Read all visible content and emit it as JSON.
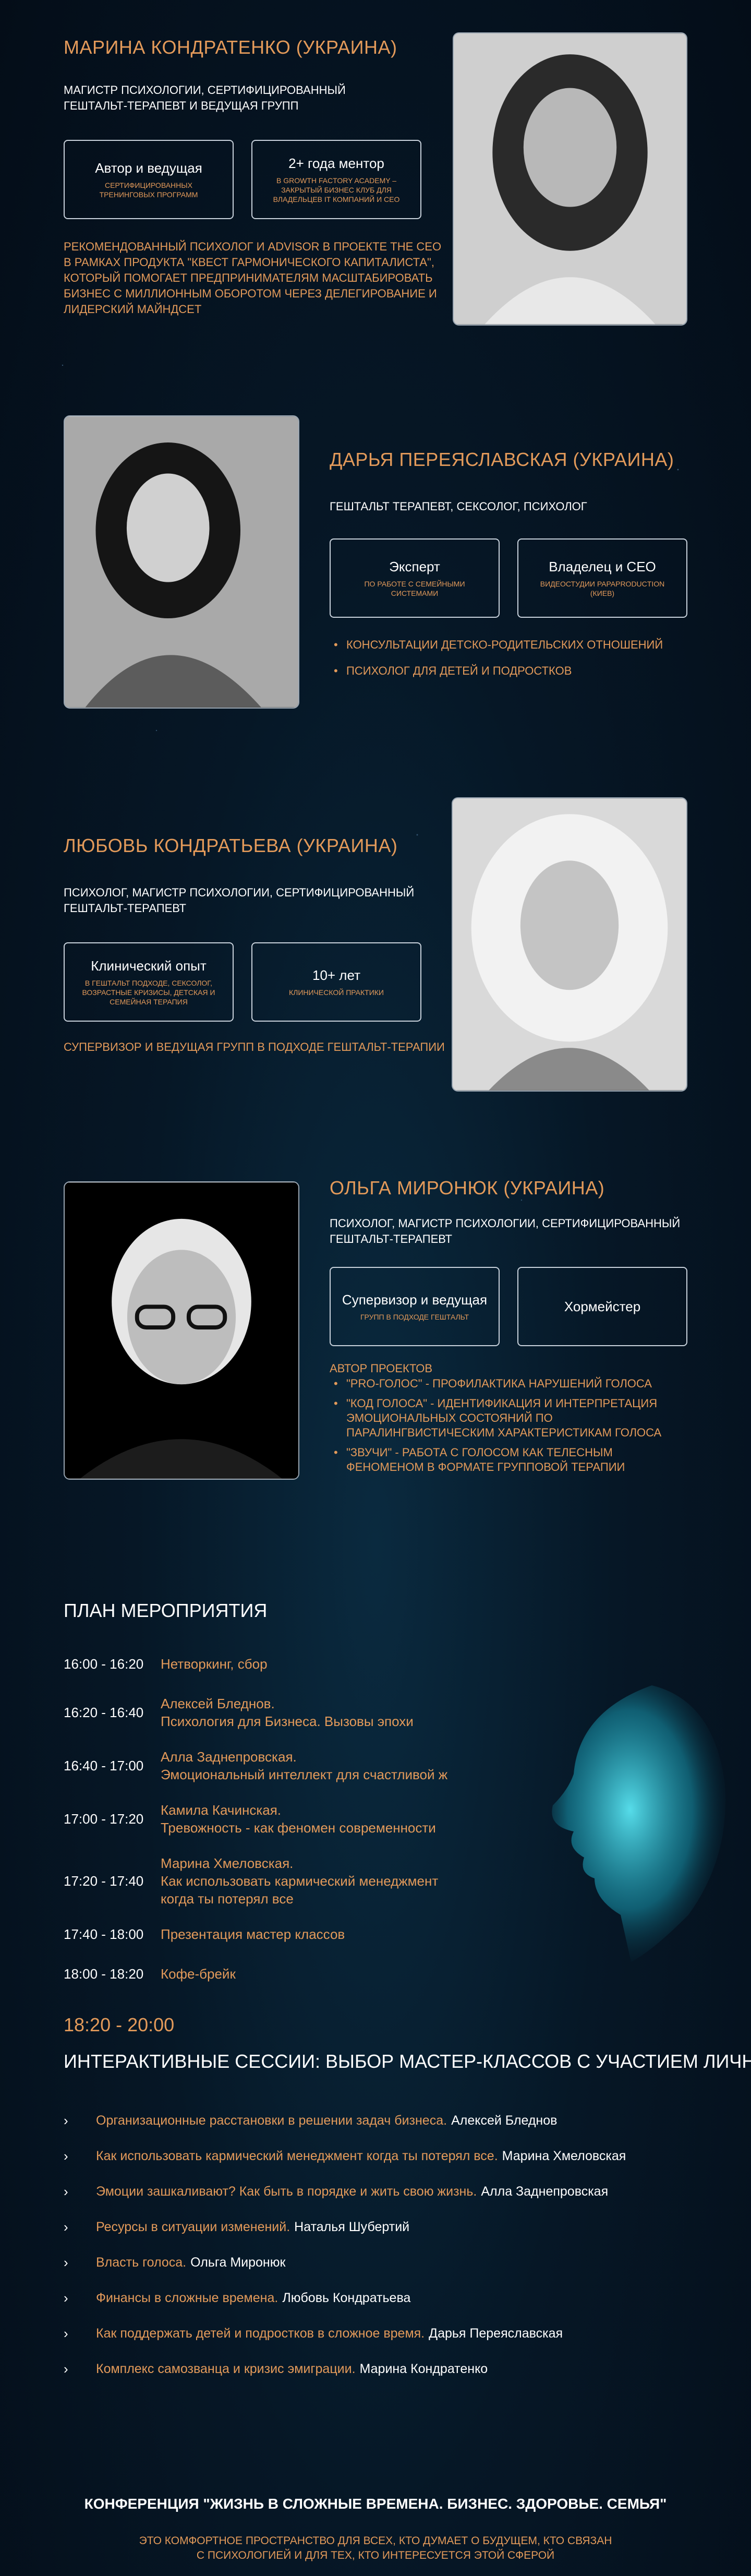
{
  "speakers": [
    {
      "name": "МАРИНА КОНДРАТЕНКО (УКРАИНА)",
      "subtitle_line1": "МАГИСТР ПСИХОЛОГИИ, СЕРТИФИЦИРОВАННЫЙ",
      "subtitle_line2": "ГЕШТАЛЬТ-ТЕРАПЕВТ И ВЕДУЩАЯ  ГРУПП",
      "cards": [
        {
          "title": "Автор и ведущая",
          "sub_line1": "СЕРТИФИЦИРОВАННЫХ",
          "sub_line2": "ТРЕНИНГОВЫХ ПРОГРАММ"
        },
        {
          "title": "2+ года ментор",
          "sub_line1": "В GROWTH FACTORY ACADEMY –",
          "sub_line2": "ЗАКРЫТЫЙ БИЗНЕС КЛУБ ДЛЯ",
          "sub_line3": "ВЛАДЕЛЬЦЕВ IT КОМПАНИЙ И CEO"
        }
      ],
      "desc_lines": [
        "РЕКОМЕНДОВАННЫЙ ПСИХОЛОГ И ADVISOR В ПРОЕКТЕ THE CEO",
        "В РАМКАХ ПРОДУКТА \"КВЕСТ ГАРМОНИЧЕСКОГО КАПИТАЛИСТА\",",
        "КОТОРЫЙ ПОМОГАЕТ ПРЕДПРИНИМАТЕЛЯМ МАСШТАБИРОВАТЬ",
        "БИЗНЕС С МИЛЛИОННЫМ ОБОРОТОМ ЧЕРЕЗ ДЕЛЕГИРОВАНИЕ И",
        "ЛИДЕРСКИЙ МАЙНДСЕТ"
      ]
    },
    {
      "name": "ДАРЬЯ ПЕРЕЯСЛАВСКАЯ (УКРАИНА)",
      "subtitle_line1": "ГЕШТАЛЬТ ТЕРАПЕВТ, СЕКСОЛОГ, ПСИХОЛОГ",
      "cards": [
        {
          "title": "Эксперт",
          "sub_line1": "ПО РАБОТЕ С СЕМЕЙНЫМИ",
          "sub_line2": "СИСТЕМАМИ"
        },
        {
          "title": "Владелец и CEO",
          "sub_line1": "ВИДЕОСТУДИИ PAPAPRODUCTION",
          "sub_line2": "(КИЕВ)"
        }
      ],
      "bullets": [
        "КОНСУЛЬТАЦИИ ДЕТСКО-РОДИТЕЛЬСКИХ ОТНОШЕНИЙ",
        "ПСИХОЛОГ ДЛЯ ДЕТЕЙ И ПОДРОСТКОВ"
      ]
    },
    {
      "name": "ЛЮБОВЬ КОНДРАТЬЕВА (УКРАИНА)",
      "subtitle_line1": "ПСИХОЛОГ, МАГИСТР ПСИХОЛОГИИ, СЕРТИФИЦИРОВАННЫЙ",
      "subtitle_line2": "ГЕШТАЛЬТ-ТЕРАПЕВТ",
      "cards": [
        {
          "title": "Клинический опыт",
          "sub_line1": "В ГЕШТАЛЬТ  ПОДХОДЕ, СЕКСОЛОГ,",
          "sub_line2": "ВОЗРАСТНЫЕ КРИЗИСЫ, ДЕТСКАЯ И",
          "sub_line3": "СЕМЕЙНАЯ ТЕРАПИЯ"
        },
        {
          "title": "10+ лет",
          "sub_line1": "КЛИНИЧЕСКОЙ ПРАКТИКИ"
        }
      ],
      "desc_lines": [
        "СУПЕРВИЗОР И ВЕДУЩАЯ ГРУПП В ПОДХОДЕ ГЕШТАЛЬТ-ТЕРАПИИ"
      ]
    },
    {
      "name": "ОЛЬГА МИРОНЮК (УКРАИНА)",
      "subtitle_line1": "ПСИХОЛОГ, МАГИСТР ПСИХОЛОГИИ, СЕРТИФИЦИРОВАННЫЙ",
      "subtitle_line2": "ГЕШТАЛЬТ-ТЕРАПЕВТ",
      "cards": [
        {
          "title": "Супервизор и ведущая",
          "sub_line1": "ГРУПП В ПОДХОДЕ ГЕШТАЛЬТ"
        },
        {
          "title": "Хормейстер"
        }
      ],
      "projects_label": "АВТОР ПРОЕКТОВ",
      "bullets": [
        "\"PRO-ГОЛОС\" - ПРОФИЛАКТИКА НАРУШЕНИЙ ГОЛОСА",
        "\"КОД ГОЛОСА\" - ИДЕНТИФИКАЦИЯ И ИНТЕРПРЕТАЦИЯ",
        "ЭМОЦИОНАЛЬНЫХ СОСТОЯНИЙ ПО",
        "ПАРАЛИНГВИСТИЧЕСКИМ ХАРАКТЕРИСТИКАМ ГОЛОСА",
        "\"ЗВУЧИ\" - РАБОТА С ГОЛОСОМ КАК ТЕЛЕСНЫМ",
        "ФЕНОМЕНОМ В ФОРМАТЕ ГРУППОВОЙ ТЕРАПИИ"
      ]
    }
  ],
  "plan": {
    "title": "ПЛАН МЕРОПРИЯТИЯ",
    "rows": [
      {
        "time": "16:00 - 16:20",
        "speaker": "",
        "topic": "Нетворкинг, сбор"
      },
      {
        "time": "16:20 - 16:40",
        "speaker": "Алексей Бледнов.",
        "topic": "Психология для Бизнеса. Вызовы эпохи"
      },
      {
        "time": "16:40 - 17:00",
        "speaker": "Алла Заднепровская.",
        "topic": "Эмоциональный интеллект для счастливой ж"
      },
      {
        "time": "17:00 - 17:20",
        "speaker": "Камила Качинская.",
        "topic": "Тревожность - как феномен современности"
      },
      {
        "time": "17:20 - 17:40",
        "speaker": "Марина Хмеловская.",
        "topic": "Как использовать кармический менеджмент",
        "topic2": "когда ты потерял все"
      },
      {
        "time": "17:40 - 18:00",
        "speaker": "",
        "topic": "Презентация мастер классов"
      },
      {
        "time": "18:00 - 18:20",
        "speaker": "",
        "topic": "Кофе-брейк"
      }
    ]
  },
  "sessions": {
    "time": "18:20 - 20:00",
    "title": "ИНТЕРАКТИВНЫЕ СЕССИИ: ВЫБОР МАСТЕР-КЛАССОВ С УЧАСТИЕМ ЛИЧНО!",
    "items": [
      {
        "topic": "Организационные расстановки в решении задач бизнеса.",
        "who": "Алексей Бледнов"
      },
      {
        "topic": "Как использовать кармический менеджмент когда ты потерял все.",
        "who": "Марина Хмеловская"
      },
      {
        "topic": "Эмоции зашкаливают? Как быть в порядке и жить свою жизнь.",
        "who": "Алла Заднепровская"
      },
      {
        "topic": "Ресурсы в ситуации изменений.",
        "who": "Наталья Шубертий"
      },
      {
        "topic": "Власть голоса.",
        "who": "Ольга Миронюк"
      },
      {
        "topic": "Финансы в сложные времена.",
        "who": "Любовь Кондратьева"
      },
      {
        "topic": "Как поддержать детей и подростков в сложное время.",
        "who": "Дарья Переяславская"
      },
      {
        "topic": "Комплекс самозванца и кризис эмиграции.",
        "who": "Марина Кондратенко"
      }
    ]
  },
  "footer": {
    "title": "КОНФЕРЕНЦИЯ \"ЖИЗНЬ В СЛОЖНЫЕ  ВРЕМЕНА. БИЗНЕС. ЗДОРОВЬЕ. СЕМЬЯ\"",
    "line1": "ЭТО КОМФОРТНОЕ ПРОСТРАНСТВО ДЛЯ ВСЕХ, КТО ДУМАЕТ О БУДУЩЕМ, КТО СВЯЗАН",
    "line2": "С ПСИХОЛОГИЕЙ И ДЛЯ ТЕХ, КТО ИНТЕРЕСУЕТСЯ ЭТОЙ СФЕРОЙ"
  },
  "colors": {
    "accent": "#e39a5a",
    "background": "#061726",
    "border": "#c9d2dc"
  }
}
